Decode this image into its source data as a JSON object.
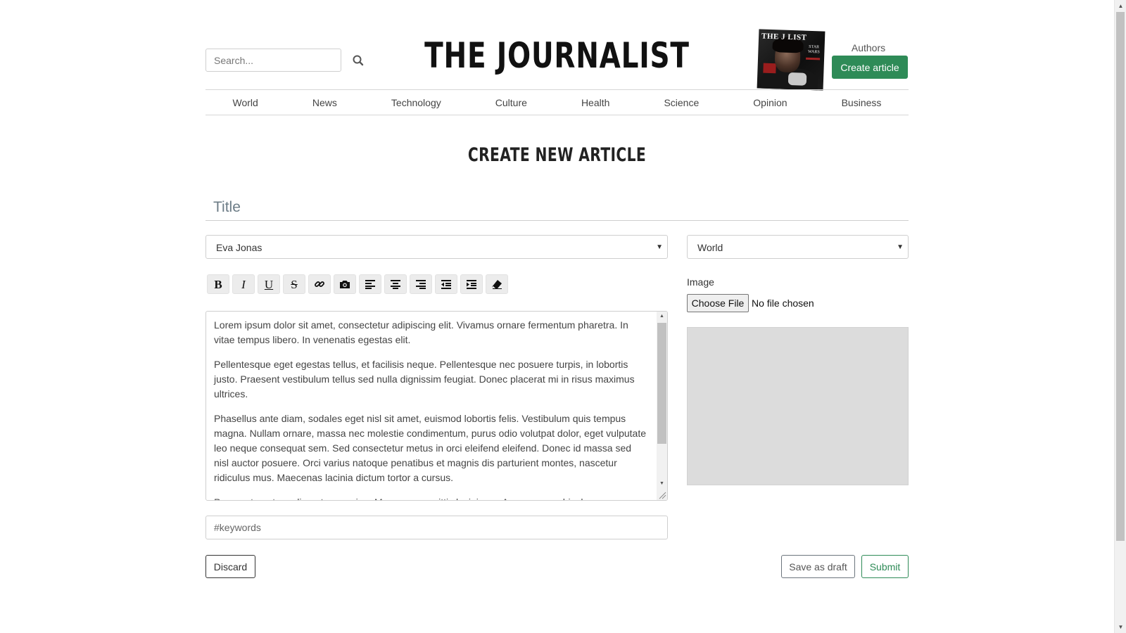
{
  "header": {
    "search_placeholder": "Search...",
    "brand": "THE JOURNALIST",
    "cover_masthead": "THE J     LIST",
    "cover_subtitle": "STAR WARS",
    "authors_label": "Authors",
    "create_article_label": "Create article"
  },
  "nav": {
    "items": [
      "World",
      "News",
      "Technology",
      "Culture",
      "Health",
      "Science",
      "Opinion",
      "Business"
    ]
  },
  "form": {
    "page_title": "CREATE NEW ARTICLE",
    "title_placeholder": "Title",
    "author_selected": "Eva Jonas",
    "section_selected": "World",
    "toolbar": [
      "bold",
      "italic",
      "underline",
      "strikethrough",
      "link",
      "image",
      "align-left",
      "align-center",
      "align-right",
      "outdent",
      "indent",
      "clear-format"
    ],
    "body_paragraphs": [
      "Lorem ipsum dolor sit amet, consectetur adipiscing elit. Vivamus ornare fermentum pharetra. In vitae tempus libero. In venenatis egestas elit.",
      "Pellentesque eget egestas tellus, et facilisis neque. Pellentesque nec posuere turpis, in lobortis justo. Praesent vestibulum tellus sed nulla dignissim feugiat. Donec placerat mi in risus maximus ultrices.",
      "Phasellus ante diam, sodales eget nisl sit amet, euismod lobortis felis. Vestibulum quis tempus magna. Nullam ornare, massa nec molestie condimentum, purus odio volutpat dolor, eget vulputate leo neque consequat sem. Sed consectetur metus in orci eleifend eleifend. Donec id massa sed nisl auctor posuere. Orci varius natoque penatibus et magnis dis parturient montes, nascetur ridiculus mus. Maecenas lacinia dictum tortor a cursus.",
      "Praesent eget condimentum sapien. Maecenas sagittis lacinia ex. Aenean eu vehicula nunc."
    ],
    "image_label": "Image",
    "choose_file_label": "Choose File",
    "file_status": "No file chosen",
    "keywords_placeholder": "#keywords",
    "discard_label": "Discard",
    "save_draft_label": "Save as draft",
    "submit_label": "Submit"
  },
  "colors": {
    "accent_green": "#2e8b57",
    "preview_gray": "#dcdcdc"
  }
}
